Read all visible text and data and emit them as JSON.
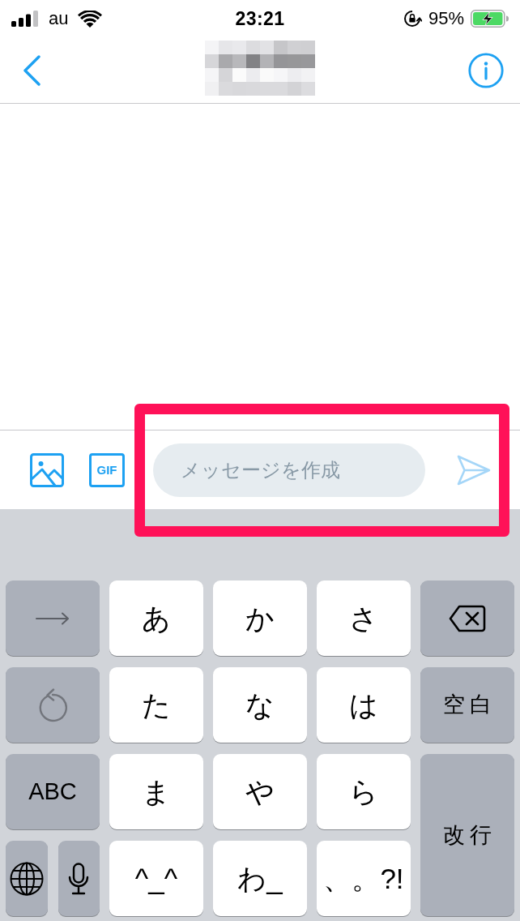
{
  "status_bar": {
    "carrier": "au",
    "time": "23:21",
    "battery": "95%"
  },
  "composer": {
    "gif_label": "GIF",
    "placeholder": "メッセージを作成",
    "send": {
      "disabled": true
    }
  },
  "keyboard": {
    "rows": [
      [
        {
          "kind": "next"
        },
        {
          "kind": "char",
          "label": "あ"
        },
        {
          "kind": "char",
          "label": "か"
        },
        {
          "kind": "char",
          "label": "さ"
        },
        {
          "kind": "delete"
        }
      ],
      [
        {
          "kind": "undo"
        },
        {
          "kind": "char",
          "label": "た"
        },
        {
          "kind": "char",
          "label": "な"
        },
        {
          "kind": "char",
          "label": "は"
        },
        {
          "kind": "space",
          "label": "空白"
        }
      ],
      [
        {
          "kind": "mode",
          "label": "ABC"
        },
        {
          "kind": "char",
          "label": "ま"
        },
        {
          "kind": "char",
          "label": "や"
        },
        {
          "kind": "char",
          "label": "ら"
        },
        {
          "kind": "return",
          "label": "改行"
        }
      ],
      [
        {
          "kind": "pair",
          "keys": [
            {
              "kind": "globe"
            },
            {
              "kind": "mic"
            }
          ]
        },
        {
          "kind": "char",
          "label": "^_^"
        },
        {
          "kind": "char",
          "label": "わ_"
        },
        {
          "kind": "char",
          "label": "、。?!"
        }
      ]
    ]
  }
}
